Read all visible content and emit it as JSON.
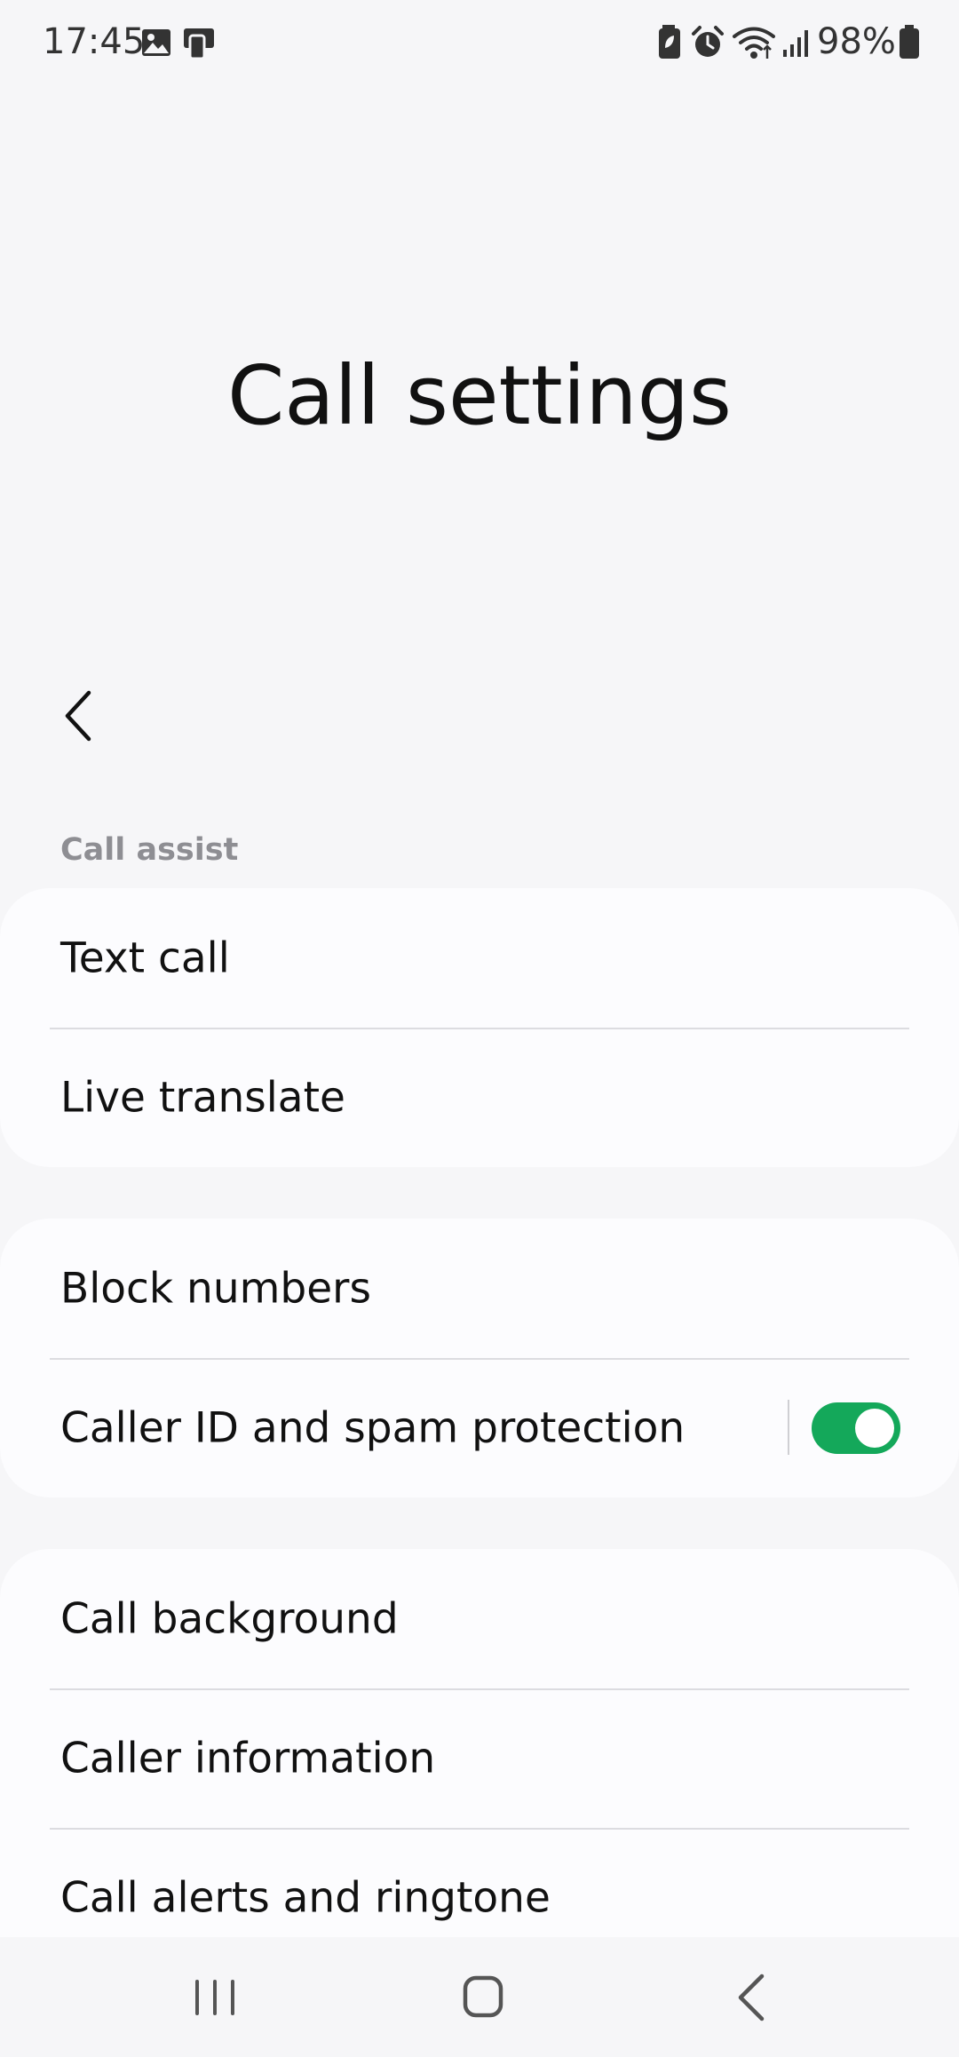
{
  "status_bar": {
    "time": "17:45",
    "battery": "98%",
    "icons": [
      "gallery-icon",
      "device-icon",
      "battery-saver-icon",
      "alarm-icon",
      "wifi-icon",
      "signal-icon",
      "battery-icon"
    ]
  },
  "header": {
    "title": "Call settings",
    "back_icon": "back-arrow-icon"
  },
  "sections": [
    {
      "header": "Call assist",
      "items": [
        {
          "label": "Text call"
        },
        {
          "label": "Live translate"
        }
      ]
    },
    {
      "header": "",
      "items": [
        {
          "label": "Block numbers"
        },
        {
          "label": "Caller ID and spam protection",
          "toggle": true
        }
      ]
    },
    {
      "header": "",
      "items": [
        {
          "label": "Call background"
        },
        {
          "label": "Caller information"
        },
        {
          "label": "Call alerts and ringtone"
        }
      ]
    }
  ],
  "colors": {
    "background": "#f6f6f8",
    "card": "#fcfcfe",
    "toggle_on": "#14a85a",
    "section_header": "#8e8e93"
  },
  "nav_bar": {
    "icons": [
      "recent-apps-icon",
      "home-icon",
      "back-icon"
    ]
  }
}
